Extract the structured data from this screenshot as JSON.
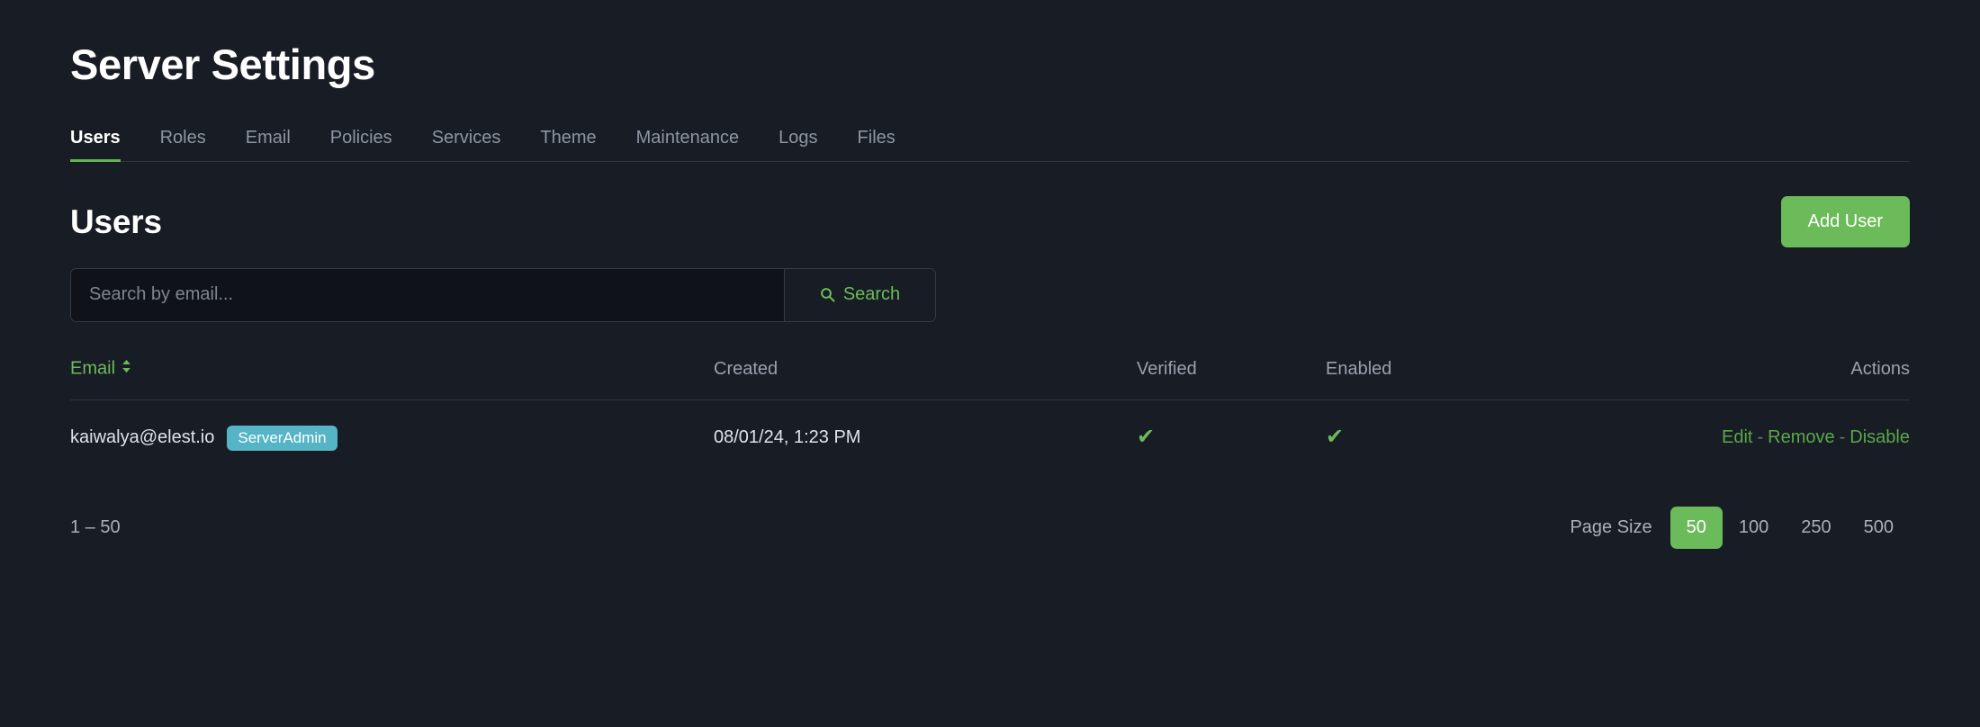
{
  "header": {
    "title": "Server Settings"
  },
  "tabs": [
    {
      "label": "Users",
      "active": true
    },
    {
      "label": "Roles",
      "active": false
    },
    {
      "label": "Email",
      "active": false
    },
    {
      "label": "Policies",
      "active": false
    },
    {
      "label": "Services",
      "active": false
    },
    {
      "label": "Theme",
      "active": false
    },
    {
      "label": "Maintenance",
      "active": false
    },
    {
      "label": "Logs",
      "active": false
    },
    {
      "label": "Files",
      "active": false
    }
  ],
  "section": {
    "title": "Users",
    "add_user_label": "Add User"
  },
  "search": {
    "placeholder": "Search by email...",
    "value": "",
    "button_label": "Search",
    "icon": "search-icon"
  },
  "table": {
    "columns": [
      {
        "key": "email",
        "label": "Email",
        "sortable": true,
        "align": "left"
      },
      {
        "key": "created",
        "label": "Created",
        "sortable": false,
        "align": "left"
      },
      {
        "key": "verified",
        "label": "Verified",
        "sortable": false,
        "align": "left"
      },
      {
        "key": "enabled",
        "label": "Enabled",
        "sortable": false,
        "align": "left"
      },
      {
        "key": "actions",
        "label": "Actions",
        "sortable": false,
        "align": "right"
      }
    ],
    "rows": [
      {
        "email": "kaiwalya@elest.io",
        "role_badge": "ServerAdmin",
        "created": "08/01/24, 1:23 PM",
        "verified": "✔",
        "enabled": "✔",
        "actions": [
          {
            "label": "Edit"
          },
          {
            "label": "Remove"
          },
          {
            "label": "Disable"
          }
        ],
        "action_separator": "-"
      }
    ]
  },
  "pagination": {
    "range": "1 – 50",
    "page_size_label": "Page Size",
    "page_sizes": [
      {
        "label": "50",
        "active": true
      },
      {
        "label": "100",
        "active": false
      },
      {
        "label": "250",
        "active": false
      },
      {
        "label": "500",
        "active": false
      }
    ]
  },
  "colors": {
    "background": "#181c24",
    "accent_green": "#6cbb5a",
    "link_green": "#5aa84a",
    "badge_teal": "#56b4c7",
    "muted_text": "#99a1ae",
    "border": "#2e3440"
  }
}
